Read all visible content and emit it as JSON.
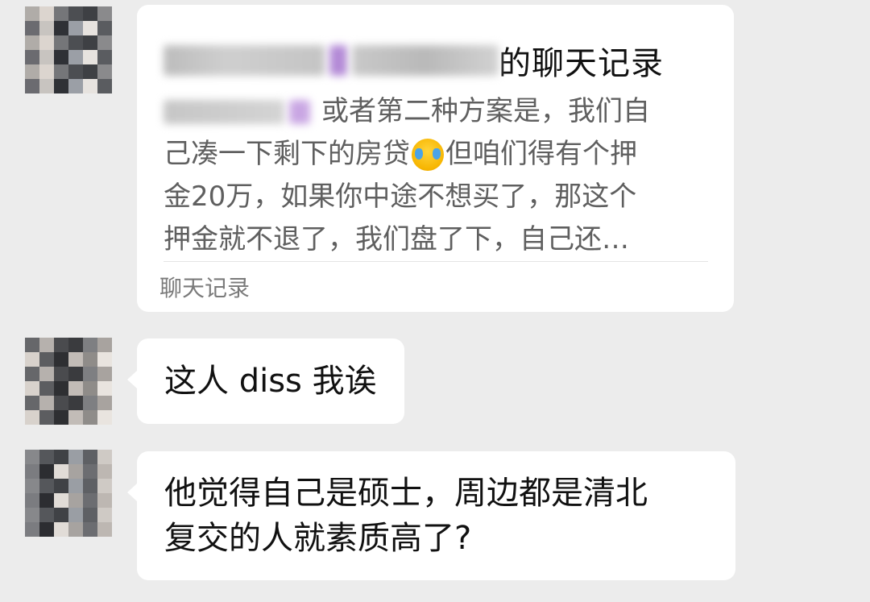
{
  "messages": [
    {
      "type": "chat-record",
      "sender_avatar": "pixelated-avatar",
      "title_suffix": "的聊天记录",
      "summary_lines": [
        "或者第二种方案是，我们自",
        "己凑一下剩下的房贷",
        "但咱们得有个押",
        "金20万，如果你中途不想买了，那这个",
        "押金就不退了，我们盘了下，自己还…"
      ],
      "summary_emoji": "crying-laughing-emoji",
      "footer": "聊天记录"
    },
    {
      "type": "text",
      "sender_avatar": "pixelated-avatar",
      "text": "这人 diss 我诶"
    },
    {
      "type": "text",
      "sender_avatar": "pixelated-avatar",
      "lines": [
        "他觉得自己是硕士，周边都是清北",
        "复交的人就素质高了?"
      ]
    }
  ],
  "colors": {
    "background": "#ececec",
    "bubble": "#ffffff",
    "text": "#111111",
    "summary_text": "#5f5f5f",
    "footer_text": "#7a7a7a"
  }
}
